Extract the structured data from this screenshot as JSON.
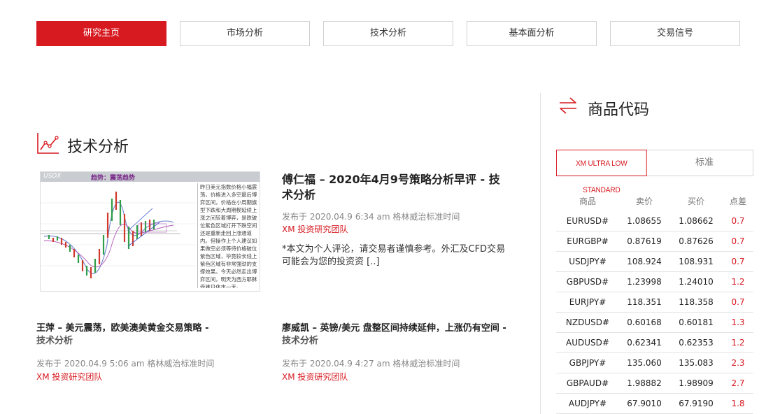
{
  "nav": {
    "tabs": [
      {
        "label": "研究主页",
        "active": true
      },
      {
        "label": "市场分析",
        "active": false
      },
      {
        "label": "技术分析",
        "active": false
      },
      {
        "label": "基本面分析",
        "active": false
      },
      {
        "label": "交易信号",
        "active": false
      }
    ]
  },
  "section": {
    "title": "技术分析",
    "icon": "line-chart-icon"
  },
  "featured": {
    "title": "傅仁福 – 2020年4月9号策略分析早评 - ",
    "category": "技术分析",
    "meta": "发布于 2020.04.9 6:34 am 格林威治标准时间",
    "author": "XM 投资研究团队",
    "excerpt": "*本文为个人评论，请交易者谨慎参考。外汇及CFD交易可能会为您的投资资 [..]",
    "thumbnail": {
      "symbol": "USDX",
      "trend_label": "趋势：震荡趋势",
      "notes": "昨日美元指数价格小幅震荡，价格进入多空最后博弈区间，价格在小周期旗型下跌和大周期楔延续上涨之间较着博弈，是跌破位紫色区域打开下跌空间还是重新走回上涨通道内。但操作上个人建议如果做空必须等待价格破位紫色区域，毕竟较长线上紫色区域有非常强劲的支撑效果。今天必然走出博弈区间，明天为西方耶稣受难日休市一天。"
    }
  },
  "articles": [
    {
      "title": "王萍 – 美元震荡，欧美澳美黄金交易策略 - ",
      "category": "技术分析",
      "meta": "发布于 2020.04.9 5:06 am 格林威治标准时间",
      "author": "XM 投资研究团队"
    },
    {
      "title": "廖威凯 – 英镑/美元 盘整区间持续延伸，上涨仍有空间 - ",
      "category": "技术分析",
      "meta": "发布于 2020.04.9 4:27 am 格林威治标准时间",
      "author": "XM 投资研究团队"
    }
  ],
  "quotes": {
    "title": "商品代码",
    "icon": "exchange-arrows-icon",
    "account_tabs": [
      {
        "label": "XM ULTRA LOW STANDARD",
        "active": true
      },
      {
        "label": "标准",
        "active": false
      }
    ],
    "headers": [
      "商品",
      "卖价",
      "买价",
      "点差"
    ],
    "rows": [
      [
        "EURUSD#",
        "1.08655",
        "1.08662",
        "0.7"
      ],
      [
        "EURGBP#",
        "0.87619",
        "0.87626",
        "0.7"
      ],
      [
        "USDJPY#",
        "108.924",
        "108.931",
        "0.7"
      ],
      [
        "GBPUSD#",
        "1.23998",
        "1.24010",
        "1.2"
      ],
      [
        "EURJPY#",
        "118.351",
        "118.358",
        "0.7"
      ],
      [
        "NZDUSD#",
        "0.60168",
        "0.60181",
        "1.3"
      ],
      [
        "AUDUSD#",
        "0.62341",
        "0.62353",
        "1.2"
      ],
      [
        "GBPJPY#",
        "135.060",
        "135.083",
        "2.3"
      ],
      [
        "GBPAUD#",
        "1.98882",
        "1.98909",
        "2.7"
      ],
      [
        "AUDJPY#",
        "67.9010",
        "67.9190",
        "1.8"
      ]
    ],
    "spread_color": "#d71920"
  },
  "colors": {
    "accent": "#d71920"
  }
}
